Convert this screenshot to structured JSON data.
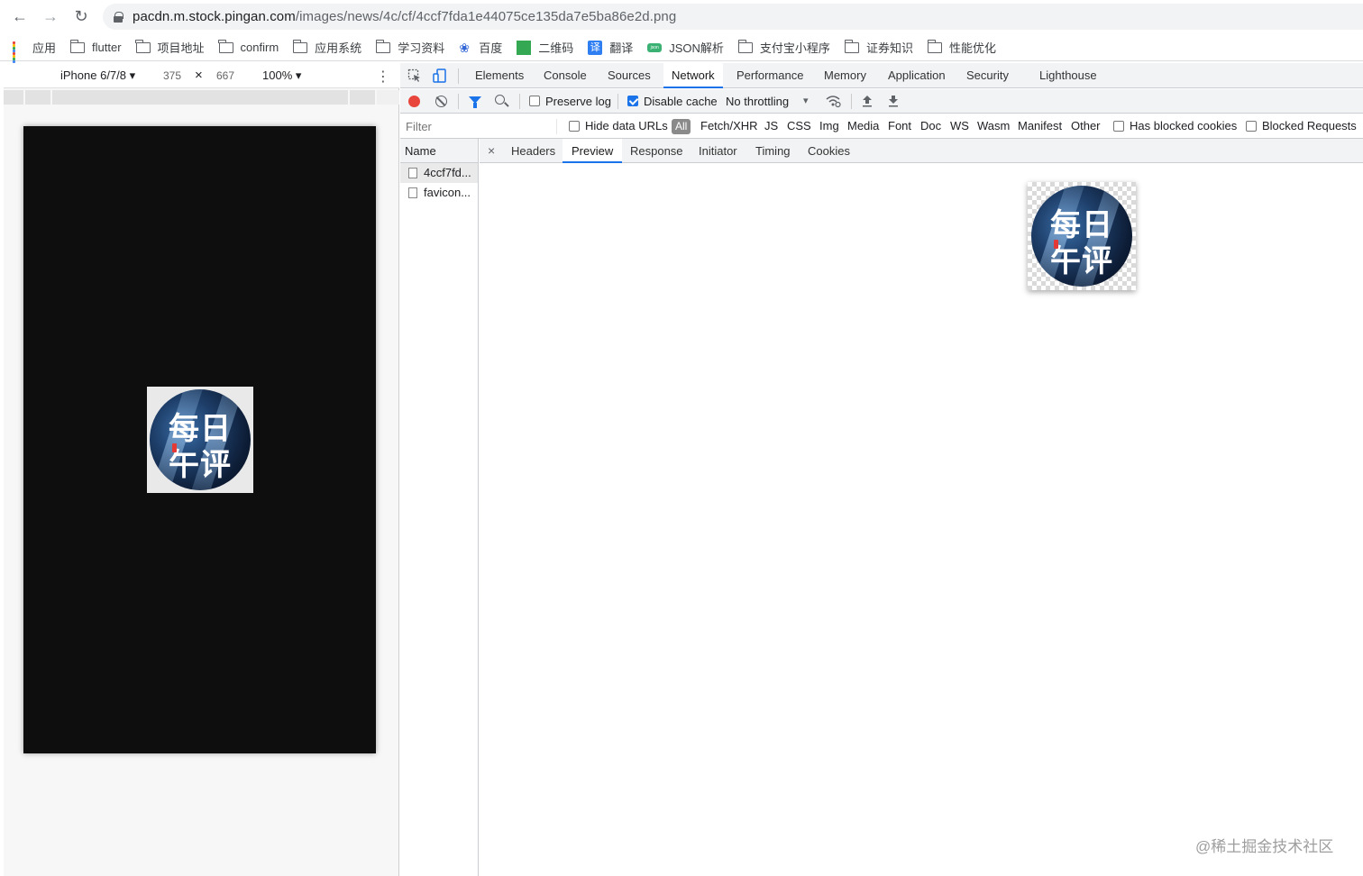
{
  "browser": {
    "url_host": "pacdn.m.stock.pingan.com",
    "url_path": "/images/news/4c/cf/4ccf7fda1e44075ce135da7e5ba86e2d.png"
  },
  "bookmarks": [
    "应用",
    "flutter",
    "项目地址",
    "confirm",
    "应用系统",
    "学习资料",
    "百度",
    "二维码",
    "翻译",
    "JSON解析",
    "支付宝小程序",
    "证券知识",
    "性能优化"
  ],
  "device_toolbar": {
    "device": "iPhone 6/7/8 ▾",
    "width": "375",
    "times": "×",
    "height": "667",
    "zoom": "100% ▾",
    "more": "⋮"
  },
  "devtools": {
    "tabs": [
      "Elements",
      "Console",
      "Sources",
      "Network",
      "Performance",
      "Memory",
      "Application",
      "Security",
      "Lighthouse"
    ],
    "active_tab": "Network",
    "toolbar": {
      "preserve_log": "Preserve log",
      "disable_cache": "Disable cache",
      "throttling": "No throttling",
      "throttle_arrow": "▾"
    },
    "filter": {
      "placeholder": "Filter",
      "hide_data_urls": "Hide data URLs",
      "all": "All",
      "types": [
        "Fetch/XHR",
        "JS",
        "CSS",
        "Img",
        "Media",
        "Font",
        "Doc",
        "WS",
        "Wasm",
        "Manifest",
        "Other"
      ],
      "has_blocked_cookies": "Has blocked cookies",
      "blocked_requests": "Blocked Requests"
    },
    "name_column": {
      "header": "Name",
      "rows": [
        "4ccf7fd...",
        "favicon..."
      ]
    },
    "detail": {
      "close": "×",
      "tabs": [
        "Headers",
        "Preview",
        "Response",
        "Initiator",
        "Timing",
        "Cookies"
      ],
      "active_tab": "Preview"
    }
  },
  "image_logo": {
    "line1": "每日",
    "line2": "午评"
  },
  "footer": "@稀土掘金技术社区",
  "colors": {
    "accent": "#1a73e8",
    "record": "#e8453c",
    "phone_bg": "#0e0e0e"
  }
}
